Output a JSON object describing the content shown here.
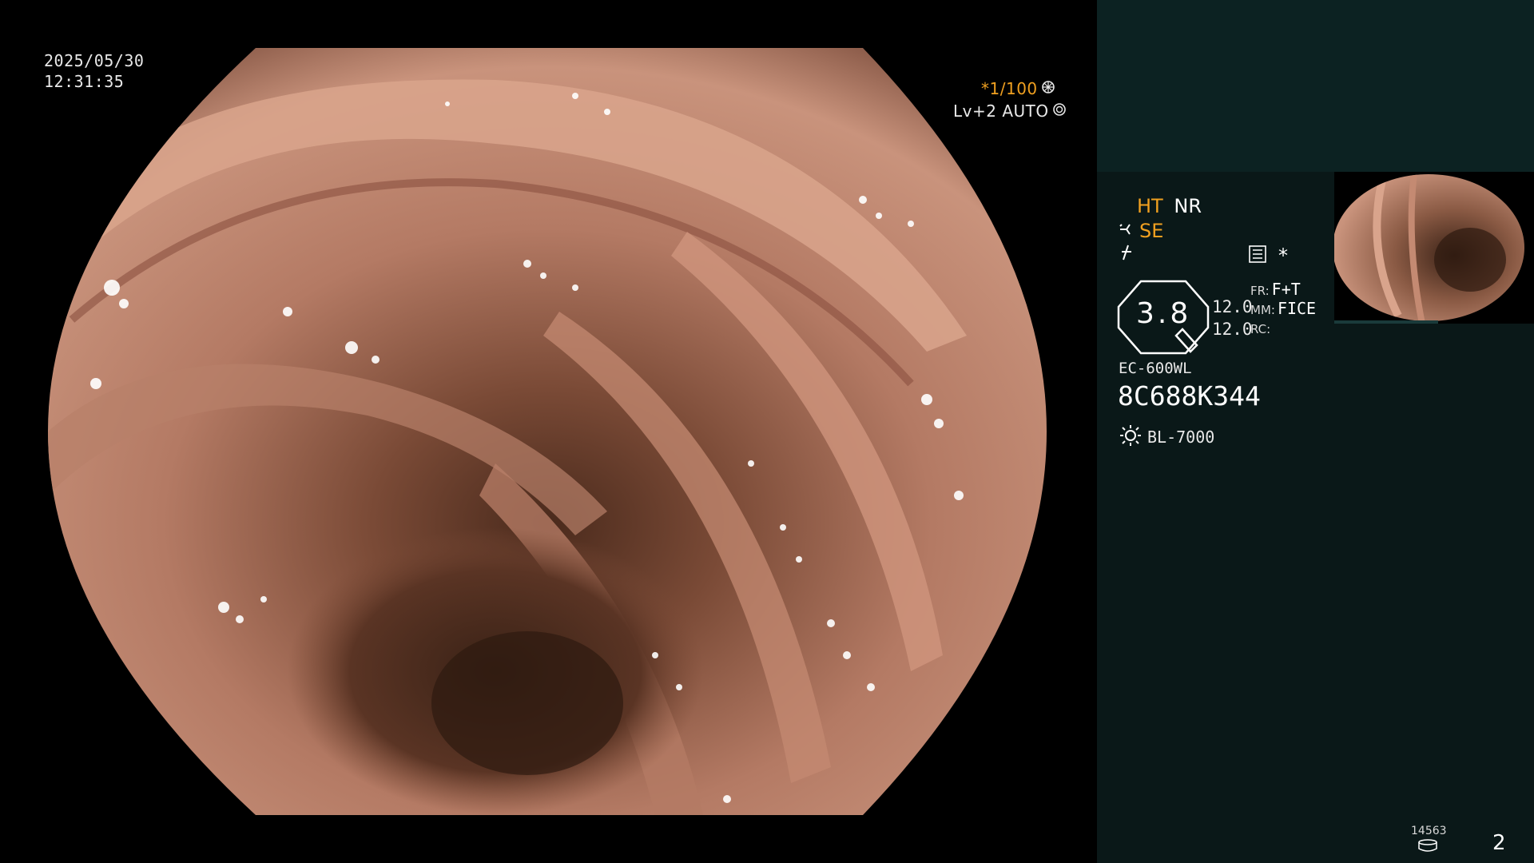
{
  "overlay": {
    "date": "2025/05/30",
    "time": "12:31:35",
    "shutter": "*1/100",
    "level": "Lv+2 AUTO"
  },
  "panel": {
    "ht": "HT",
    "nr": "NR",
    "se": "SE",
    "zoom_value": "3.8",
    "val_1": "12.0",
    "val_2": "12.0",
    "fr_label": "FR:",
    "fr_value": "F+T",
    "mm_label": "MM:",
    "mm_value": "FICE",
    "rc_label": "RC:",
    "scope_model": "EC-600WL",
    "scope_serial": "8C688K344",
    "light_source": "BL-7000",
    "image_count": "14563",
    "page_number": "2",
    "asterisk": "*"
  },
  "colors": {
    "panel_bg": "#0a1818",
    "panel_top_bg": "#0c2222",
    "accent_amber": "#f0a020"
  },
  "icons": [
    "shutter-icon",
    "auto-exposure-icon",
    "structure-enhance-icon",
    "color-enhance-icon",
    "settings-list-icon",
    "lens-icon",
    "light-source-icon",
    "storage-icon"
  ]
}
